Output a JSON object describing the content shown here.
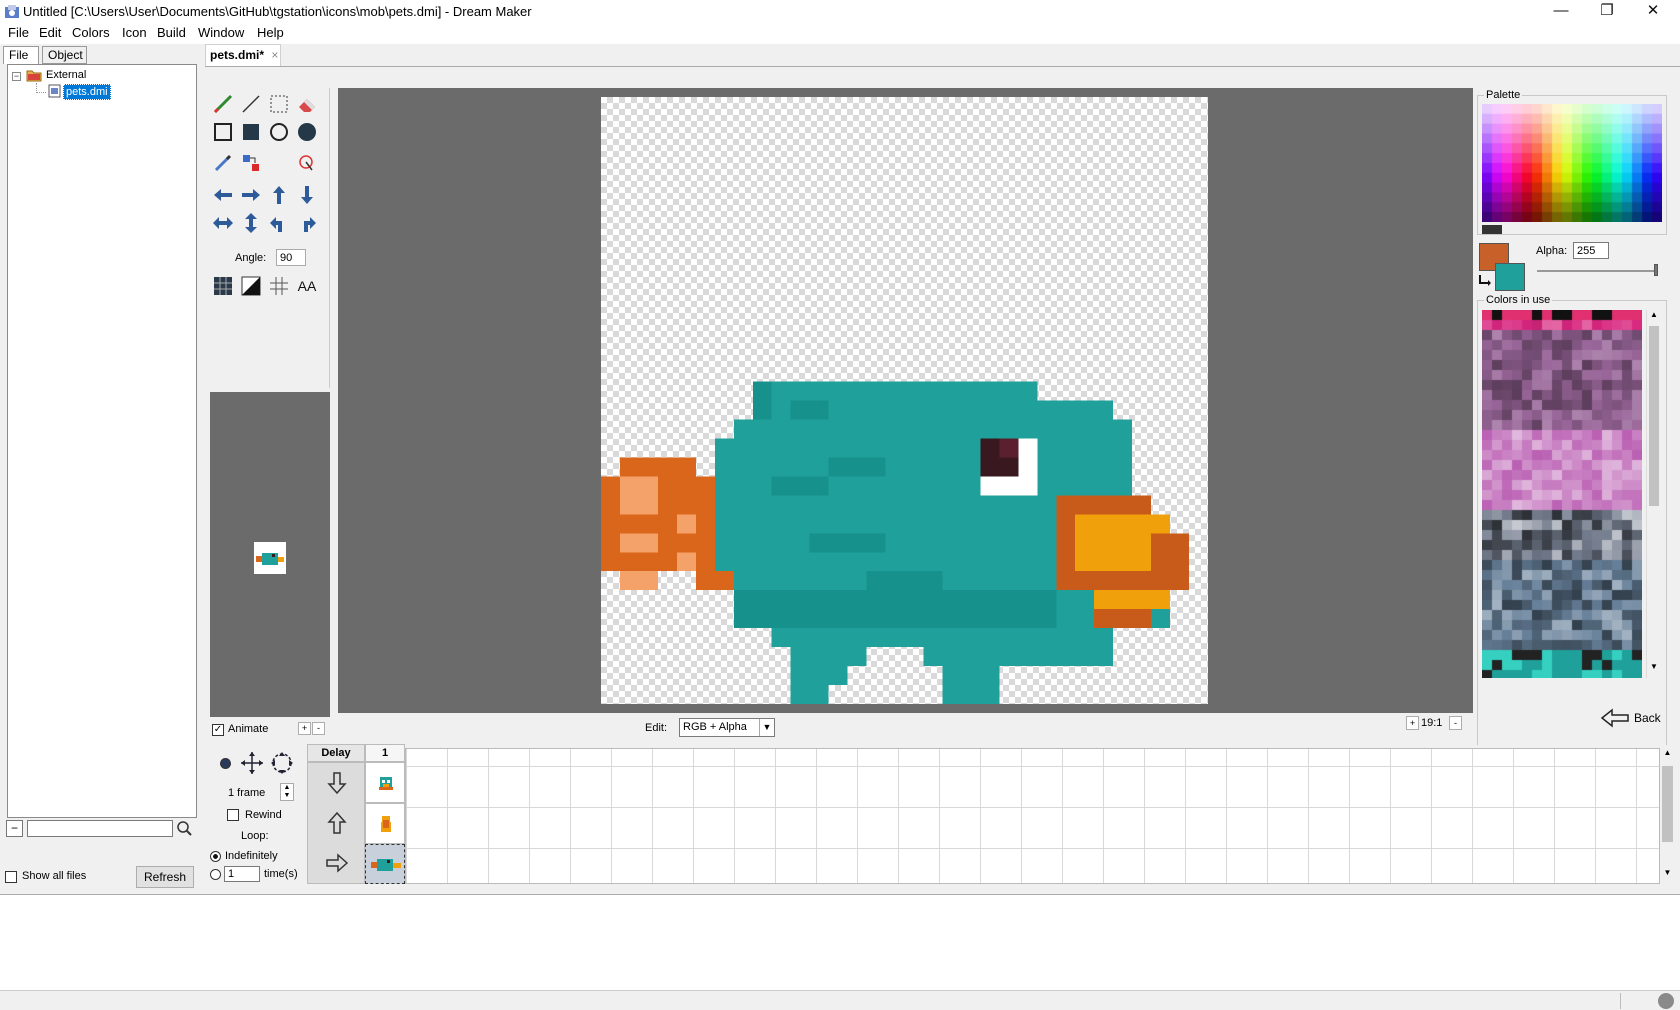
{
  "window": {
    "title": "Untitled [C:\\Users\\User\\Documents\\GitHub\\tgstation\\icons\\mob\\pets.dmi] - Dream Maker",
    "minimize": "—",
    "maximize": "❐",
    "close": "✕"
  },
  "menu": [
    "File",
    "Edit",
    "Colors",
    "Icon",
    "Build",
    "Window",
    "Help"
  ],
  "left_tabs": [
    "File",
    "Object"
  ],
  "tree": {
    "root": "External",
    "child": "pets.dmi",
    "toggle": "−"
  },
  "search": {
    "value": ""
  },
  "show_all_files": "Show all files",
  "refresh": "Refresh",
  "doc_tab": {
    "label": "pets.dmi*",
    "close": "×"
  },
  "tools": {
    "angle_label": "Angle:",
    "angle_value": "90",
    "aa_label": "AA"
  },
  "animate": {
    "label": "Animate",
    "checked": true
  },
  "edit": {
    "label": "Edit:",
    "value": "RGB + Alpha"
  },
  "zoom": "19:1",
  "palette": {
    "title": "Palette",
    "alpha_label": "Alpha:",
    "alpha_value": "255",
    "primary_color": "#c8602a",
    "secondary_color": "#1fa09a",
    "colors_in_use": "Colors in use"
  },
  "back_button": "Back",
  "frames": {
    "count": "1 frame",
    "rewind": "Rewind",
    "loop": "Loop:",
    "indefinitely": "Indefinitely",
    "times_value": "1",
    "times_label": "time(s)",
    "delay_header": "Delay",
    "col_header": "1"
  },
  "colors": {
    "teal": "#1fa09a",
    "teal_dark": "#17918b",
    "orange": "#d9661b",
    "orange_light": "#f5a26a",
    "beak": "#f0a00a",
    "beak_dark": "#c95b1a",
    "eye": "#3a1820"
  }
}
